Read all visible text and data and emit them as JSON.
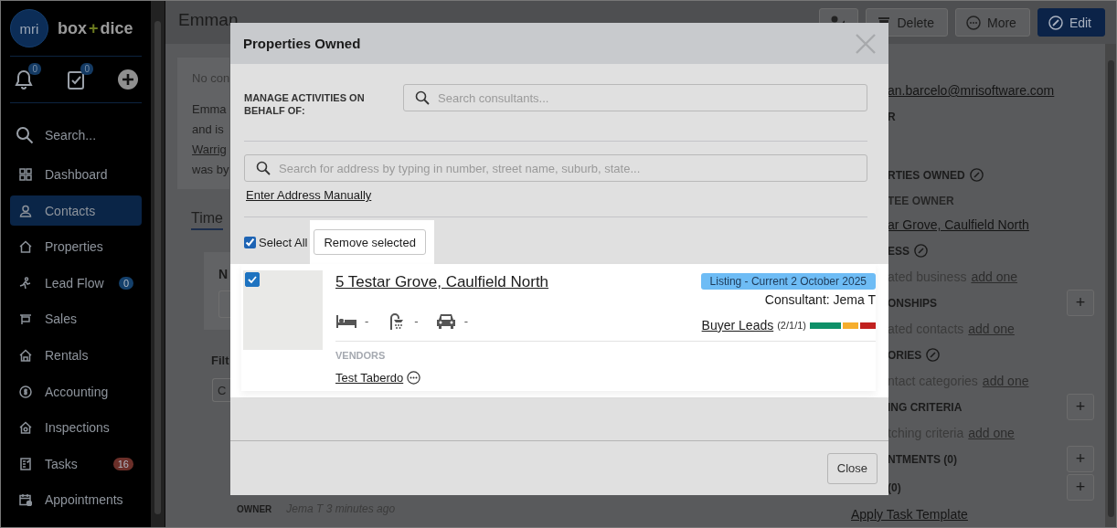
{
  "brand": {
    "mark": "mri",
    "left": "box",
    "plus": "+",
    "right": "dice"
  },
  "quick_actions": {
    "notifications_badge": "0",
    "tasks_badge": "0"
  },
  "sidebar": {
    "search": "Search...",
    "items": [
      {
        "kind": "dashboard",
        "label": "Dashboard",
        "selected": false
      },
      {
        "kind": "contacts",
        "label": "Contacts",
        "selected": true
      },
      {
        "kind": "properties",
        "label": "Properties",
        "selected": false
      },
      {
        "kind": "leadflow",
        "label": "Lead Flow",
        "selected": false,
        "badge": "0",
        "color": "#14406b"
      },
      {
        "kind": "sales",
        "label": "Sales",
        "selected": false
      },
      {
        "kind": "rentals",
        "label": "Rentals",
        "selected": false
      },
      {
        "kind": "accounting",
        "label": "Accounting",
        "selected": false
      },
      {
        "kind": "inspections",
        "label": "Inspections",
        "selected": false
      },
      {
        "kind": "tasks",
        "label": "Tasks",
        "selected": false,
        "badge": "16",
        "color": "#6b2f29"
      },
      {
        "kind": "appointments",
        "label": "Appointments",
        "selected": false
      }
    ]
  },
  "page": {
    "title": "Emman",
    "actions": [
      {
        "kind": "aml"
      },
      {
        "kind": "delete",
        "label": "Delete"
      },
      {
        "kind": "more",
        "label": "More"
      },
      {
        "kind": "edit",
        "label": "Edit"
      }
    ]
  },
  "left_panel": {
    "summary": [
      {
        "kind": "muted",
        "text": "No con"
      },
      {
        "kind": "text",
        "text": "Emma"
      },
      {
        "kind": "text",
        "text": "and is"
      },
      {
        "kind": "link",
        "text": "Warrig"
      },
      {
        "kind": "text",
        "text": "was by"
      }
    ],
    "tab": "Time",
    "card_heading": "N",
    "filter_heading": "Filt",
    "filter_button": "C",
    "owner_label": "OWNER",
    "activity_meta": "Jema T 3 minutes ago"
  },
  "right_panel": {
    "rows": [
      {
        "kind": "link",
        "text": "an.barcelo@mrisoftware.com"
      },
      {
        "kind": "heading",
        "text": "R"
      },
      {
        "kind": "spacer"
      },
      {
        "kind": "heading",
        "text": "RTIES OWNED",
        "edit_icon": true
      },
      {
        "kind": "subheading",
        "text": "TEE OWNER"
      },
      {
        "kind": "link",
        "text": "ar Grove, Caulfield North"
      },
      {
        "kind": "heading",
        "text": "ESS",
        "edit_icon": true
      },
      {
        "kind": "empty",
        "text": "ated business",
        "link": "add one"
      },
      {
        "kind": "heading",
        "text": "ONSHIPS",
        "add": "+"
      },
      {
        "kind": "empty",
        "text": "ated contacts",
        "link": "add one"
      },
      {
        "kind": "heading",
        "text": "ORIES",
        "edit_icon": true
      },
      {
        "kind": "empty",
        "text": "ntact categories",
        "link": "add one"
      },
      {
        "kind": "heading",
        "text": "ING CRITERIA",
        "add": "+"
      },
      {
        "kind": "empty",
        "text": "tching criteria",
        "link": "add one"
      },
      {
        "kind": "heading",
        "text": "NTMENTS (0)",
        "add": "+"
      },
      {
        "kind": "heading",
        "text": "(0)",
        "add": "+"
      }
    ],
    "footer_link": "Apply Task Template"
  },
  "modal": {
    "title": "Properties Owned",
    "behalf_label": "MANAGE ACTIVITIES ON BEHALF OF:",
    "consultant_search": {
      "placeholder": "Search consultants..."
    },
    "address_search": {
      "placeholder": "Search for address by typing in number, street name, suburb, state..."
    },
    "manual_link": "Enter Address Manually",
    "select_all": {
      "label": "Select All",
      "checked": true
    },
    "remove_button": "Remove selected",
    "properties": [
      {
        "checked": true,
        "address": "5 Testar Grove, Caulfield North",
        "status": "Listing - Current 2 October 2025",
        "consultant": "Consultant: Jema T",
        "features": [
          {
            "kind": "bed",
            "value": "-"
          },
          {
            "kind": "bath",
            "value": "-"
          },
          {
            "kind": "car",
            "value": "-"
          }
        ],
        "buyer_leads": {
          "label": "Buyer Leads",
          "counts": "(2/1/1)",
          "segments": [
            {
              "color": "#0e9068"
            },
            {
              "color": "#0e9068"
            },
            {
              "color": "#f6ae2d"
            },
            {
              "color": "#c1211f"
            }
          ]
        },
        "vendors_label": "VENDORS",
        "vendors": [
          "Test Taberdo"
        ]
      }
    ],
    "close_button": "Close"
  }
}
